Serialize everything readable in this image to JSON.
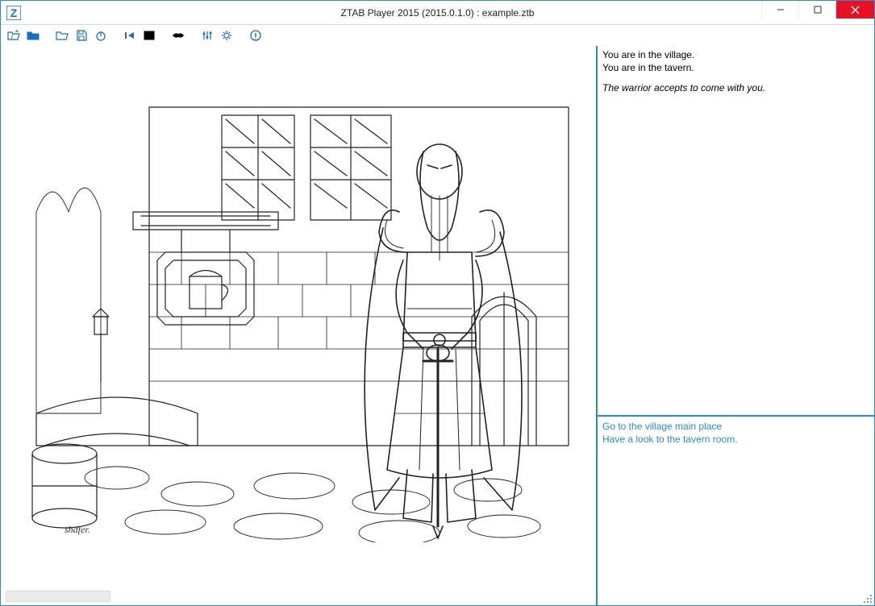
{
  "window": {
    "title": "ZTAB Player 2015 (2015.0.1.0) : example.ztb",
    "app_icon_letter": "Z"
  },
  "toolbar": {
    "open_folder": "Open",
    "folder": "Folder",
    "open_file": "Open File",
    "save": "Save",
    "power": "Power",
    "rewind": "Rewind",
    "fullscreen": "Fullscreen",
    "mask": "Mask",
    "equalizer": "Equalizer",
    "settings": "Settings",
    "info": "Info"
  },
  "narration": {
    "lines": [
      "You are in the village.",
      "You are in the tavern."
    ],
    "emphasis": "The warrior accepts to come with you."
  },
  "choices": [
    "Go to the village main place",
    "Have a look to the tavern room."
  ],
  "scene": {
    "signature": "shdfer."
  }
}
